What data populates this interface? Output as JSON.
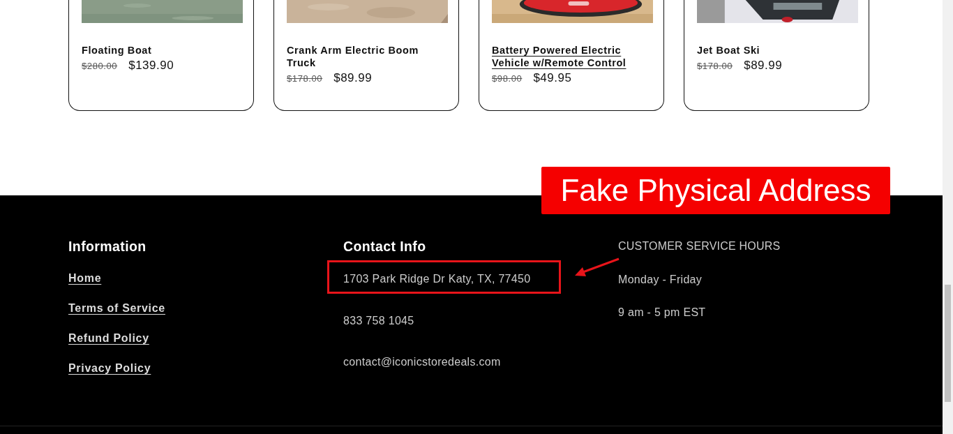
{
  "products": [
    {
      "title": "Floating Boat",
      "old_price": "$280.00",
      "price": "$139.90",
      "hovered": false
    },
    {
      "title": "Crank Arm Electric Boom Truck",
      "old_price": "$178.00",
      "price": "$89.99",
      "hovered": false
    },
    {
      "title": "Battery Powered Electric Vehicle w/Remote Control",
      "old_price": "$98.00",
      "price": "$49.95",
      "hovered": true
    },
    {
      "title": "Jet Boat Ski",
      "old_price": "$178.00",
      "price": "$89.99",
      "hovered": false
    }
  ],
  "footer": {
    "information": {
      "heading": "Information",
      "links": [
        "Home",
        "Terms of Service",
        "Refund Policy",
        "Privacy Policy"
      ]
    },
    "contact": {
      "heading": "Contact Info",
      "address": "1703 Park Ridge Dr Katy, TX, 77450",
      "phone": "833 758 1045",
      "email": "contact@iconicstoredeals.com"
    },
    "hours": {
      "heading": "CUSTOMER SERVICE HOURS",
      "lines": [
        "Monday - Friday",
        "9 am - 5 pm EST"
      ]
    }
  },
  "annotation": {
    "label": "Fake Physical Address"
  }
}
